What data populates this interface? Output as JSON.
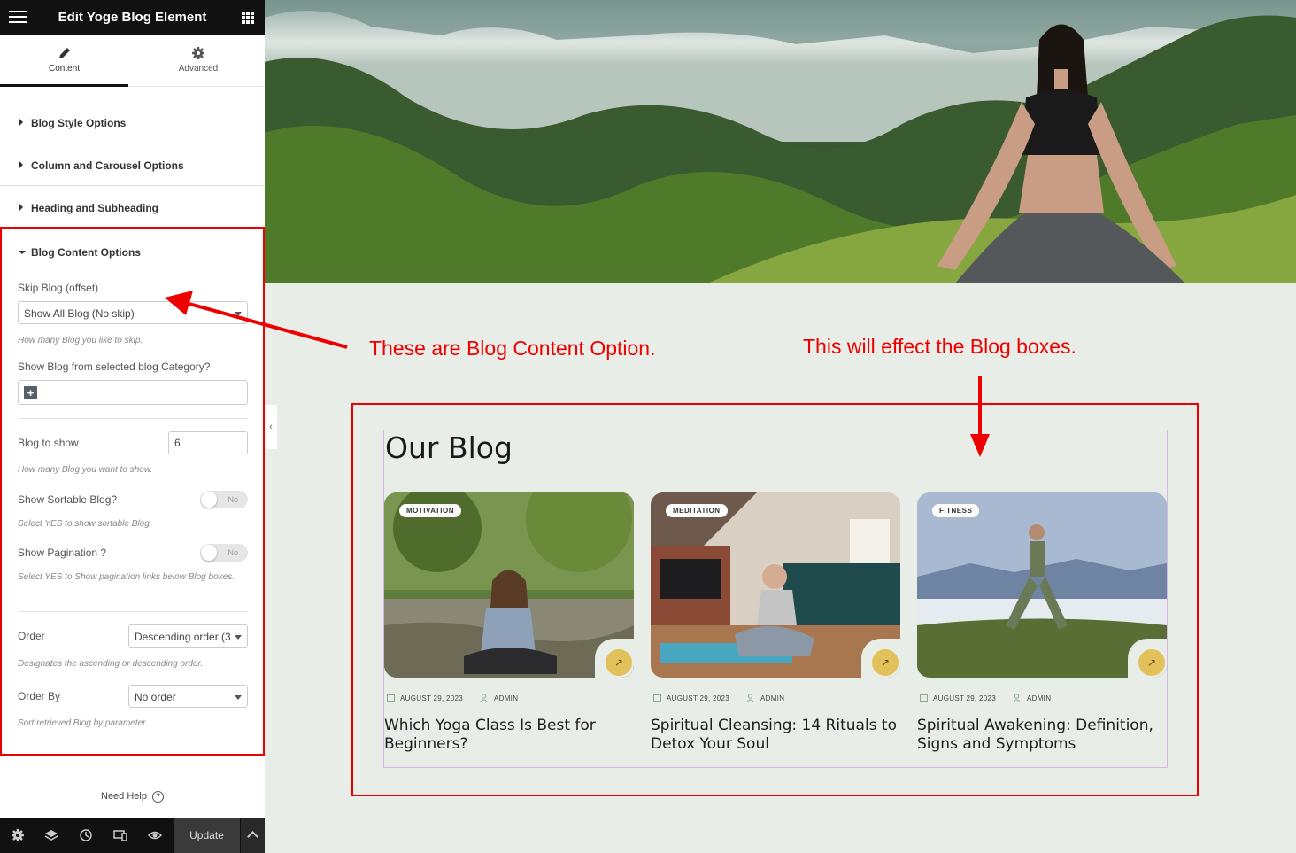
{
  "app": {
    "title": "Edit Yoge Blog Element"
  },
  "tabs": {
    "content": "Content",
    "advanced": "Advanced"
  },
  "sections": [
    "Blog Style Options",
    "Column and Carousel Options",
    "Heading and Subheading"
  ],
  "blog_content": {
    "title": "Blog Content Options",
    "skip_label": "Skip Blog (offset)",
    "skip_value": "Show All Blog (No skip)",
    "skip_hint": "How many Blog you like to skip.",
    "category_label": "Show Blog from selected blog Category?",
    "count_label": "Blog to show",
    "count_value": "6",
    "count_hint": "How many Blog you want to show.",
    "sortable_label": "Show Sortable Blog?",
    "sortable_value": "No",
    "sortable_hint": "Select YES to show sortable Blog.",
    "pagination_label": "Show Pagination ?",
    "pagination_value": "No",
    "pagination_hint": "Select YES to Show pagination links below Blog boxes.",
    "order_label": "Order",
    "order_value": "Descending order (3",
    "order_hint": "Designates the ascending or descending order.",
    "orderby_label": "Order By",
    "orderby_value": "No order",
    "orderby_hint": "Sort retrieved Blog by parameter."
  },
  "help": {
    "label": "Need Help",
    "icon": "?"
  },
  "footer": {
    "update": "Update"
  },
  "annotations": {
    "left": "These are Blog Content Option.",
    "right": "This will effect the Blog boxes."
  },
  "blog": {
    "heading": "Our Blog",
    "cards": [
      {
        "tag": "MOTIVATION",
        "date": "AUGUST 29, 2023",
        "author": "ADMIN",
        "title": "Which Yoga Class Is Best for Beginners?"
      },
      {
        "tag": "MEDITATION",
        "date": "AUGUST 29, 2023",
        "author": "ADMIN",
        "title": "Spiritual Cleansing: 14 Rituals to Detox Your Soul"
      },
      {
        "tag": "FITNESS",
        "date": "AUGUST 29, 2023",
        "author": "ADMIN",
        "title": "Spiritual Awakening: Definition, Signs and Symptoms"
      }
    ]
  },
  "colors": {
    "accent_red": "#e00000",
    "canvas_bg": "#e8ede8",
    "button_gold": "#e2c15b"
  }
}
